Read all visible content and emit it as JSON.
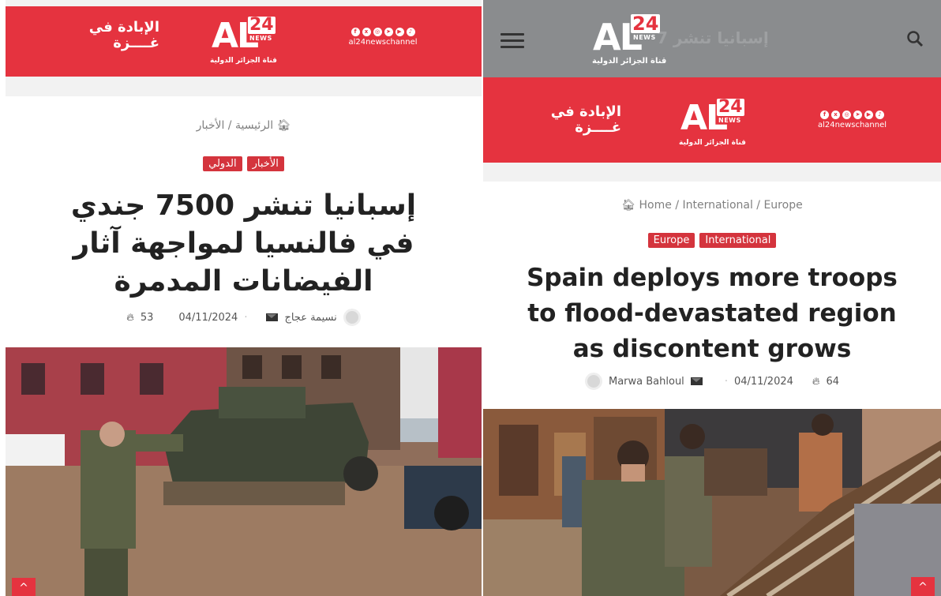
{
  "arabic": {
    "banner": {
      "genocide_line1": "الإبادة في",
      "genocide_line2": "غــــزة",
      "logo_letters": "AL",
      "logo_number": "24",
      "logo_news": "NEWS",
      "logo_subtitle": "قناة الجزائر الدولية",
      "social_handle": "al24newschannel"
    },
    "breadcrumb": "الرئيسية / الأخبار",
    "tags": [
      "الأخبار",
      "الدولي"
    ],
    "headline_lines": [
      "إسبانيا تنشر 7500 جندي",
      "في فالنسيا لمواجهة آثار",
      "الفيضانات المدمرة"
    ],
    "author": "نسيمة عجاج",
    "date": "04/11/2024",
    "views": "53",
    "scroll_top": "^"
  },
  "english": {
    "topbar": {
      "ghost_text": "إسبانيا تنشر 7",
      "logo_letters": "AL",
      "logo_number": "24",
      "logo_news": "NEWS",
      "logo_subtitle": "قناة الجزائر الدولية"
    },
    "banner": {
      "genocide_line1": "الإبادة في",
      "genocide_line2": "غــــزة",
      "logo_letters": "AL",
      "logo_number": "24",
      "logo_news": "NEWS",
      "logo_subtitle": "قناة الجزائر الدولية",
      "social_handle": "al24newschannel"
    },
    "breadcrumb": "Home / International / Europe",
    "tags": [
      "Europe",
      "International"
    ],
    "headline_lines": [
      "Spain deploys more troops",
      "to flood-devastated region",
      "as discontent grows"
    ],
    "author": "Marwa Bahloul",
    "date": "04/11/2024",
    "views": "64",
    "scroll_top": "^"
  },
  "icons": {
    "home": "home-icon",
    "mail": "envelope-icon",
    "views": "flame-icon",
    "menu": "hamburger-icon",
    "search": "search-icon"
  },
  "colors": {
    "brand_red": "#e5333f",
    "tag_red": "#d4343d",
    "topbar_grey": "#8a8c8e"
  }
}
